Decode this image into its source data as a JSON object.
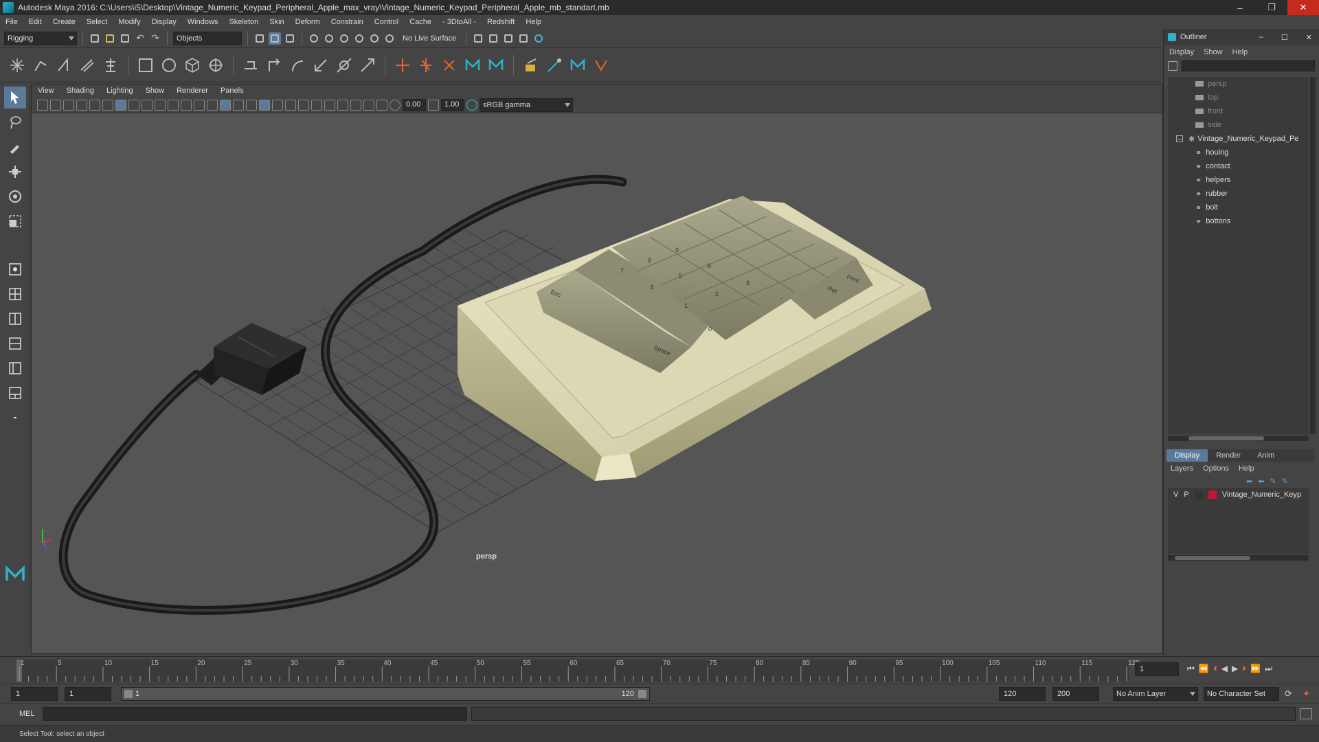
{
  "window": {
    "title": "Autodesk Maya 2016: C:\\Users\\i5\\Desktop\\Vintage_Numeric_Keypad_Peripheral_Apple_max_vray\\Vintage_Numeric_Keypad_Peripheral_Apple_mb_standart.mb",
    "minimize": "–",
    "maximize": "❐",
    "close": "✕"
  },
  "menubar": [
    "File",
    "Edit",
    "Create",
    "Select",
    "Modify",
    "Display",
    "Windows",
    "Skeleton",
    "Skin",
    "Deform",
    "Constrain",
    "Control",
    "Cache",
    "- 3DtoAll -",
    "Redshift",
    "Help"
  ],
  "statusline": {
    "menuset": "Rigging",
    "selection_mode": "Objects",
    "live_surface": "No Live Surface"
  },
  "viewport": {
    "menus": [
      "View",
      "Shading",
      "Lighting",
      "Show",
      "Renderer",
      "Panels"
    ],
    "exposure": "0.00",
    "gamma": "1.00",
    "colorspace": "sRGB gamma",
    "camera_label": "persp"
  },
  "keypad_labels": {
    "esc": "Esc",
    "space": "Space",
    "ret": "Ret",
    "print": "Print",
    "k7": "7",
    "k8": "8",
    "k9": "9",
    "k4": "4",
    "k5": "5",
    "k6": "6",
    "k1": "1",
    "k2": "2",
    "k3": "3",
    "k0": "0",
    "dot": "."
  },
  "outliner": {
    "title": "Outliner",
    "menus": [
      "Display",
      "Show",
      "Help"
    ],
    "cameras": [
      "persp",
      "top",
      "front",
      "side"
    ],
    "root": "Vintage_Numeric_Keypad_Pe",
    "children": [
      "houing",
      "contact",
      "helpers",
      "rubber",
      "bolt",
      "bottons"
    ]
  },
  "layer_editor": {
    "tabs": [
      "Display",
      "Render",
      "Anim"
    ],
    "menus": [
      "Layers",
      "Options",
      "Help"
    ],
    "layer": {
      "v": "V",
      "p": "P",
      "name": "Vintage_Numeric_Keyp",
      "color": "#c8143c"
    }
  },
  "timeline": {
    "ticks": [
      "1",
      "5",
      "10",
      "15",
      "20",
      "25",
      "30",
      "35",
      "40",
      "45",
      "50",
      "55",
      "60",
      "65",
      "70",
      "75",
      "80",
      "85",
      "90",
      "95",
      "100",
      "105",
      "110",
      "115",
      "120"
    ],
    "current_frame": "1"
  },
  "range": {
    "start": "1",
    "playback_start": "1",
    "slider_start": "1",
    "slider_end": "120",
    "playback_end": "120",
    "end": "200",
    "anim_layer": "No Anim Layer",
    "character_set": "No Character Set"
  },
  "cmdline": {
    "label": "MEL"
  },
  "helpline": {
    "text": "Select Tool: select an object"
  }
}
